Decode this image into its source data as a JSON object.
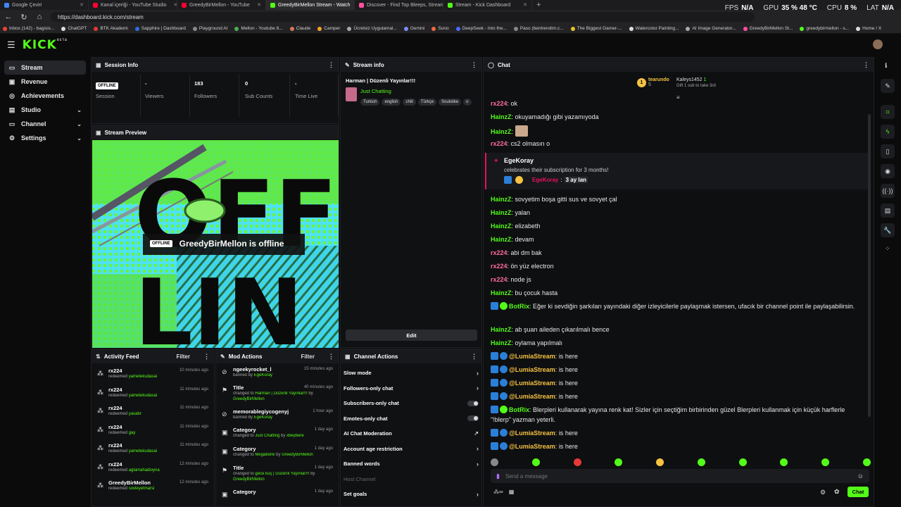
{
  "browser": {
    "tabs": [
      {
        "label": "Google Çeviri",
        "color": "#4285f4"
      },
      {
        "label": "Kanal içeriği - YouTube Studio",
        "color": "#ff0033"
      },
      {
        "label": "GreedyBirMellon - YouTube",
        "color": "#ff0033"
      },
      {
        "label": "GreedyBirMellon Stream - Watch",
        "color": "#53fc18"
      },
      {
        "label": "Discover - Find Top Bleeps, Stream",
        "color": "#ff4fa0"
      },
      {
        "label": "Stream - Kick Dashboard",
        "color": "#53fc18"
      }
    ],
    "new_tab": "+",
    "url": "https://dashboard.kick.com/stream",
    "perf": {
      "fps_label": "FPS",
      "fps_value": "N/A",
      "gpu_label": "GPU",
      "gpu_value": "35 %  48 °C",
      "cpu_label": "CPU",
      "cpu_value": "8 %",
      "lat_label": "LAT",
      "lat_value": "N/A"
    },
    "bookmarks": [
      {
        "label": "Inbox (142) - bagisis...",
        "color": "#ea4335"
      },
      {
        "label": "ChatGPT",
        "color": "#ddd"
      },
      {
        "label": "BTK Akademi",
        "color": "#e53935"
      },
      {
        "label": "Sapphire | Dashboard",
        "color": "#2d6cdf"
      },
      {
        "label": "Playground AI",
        "color": "#888"
      },
      {
        "label": "Mellon - Youtube 8...",
        "color": "#4caf50"
      },
      {
        "label": "Claude",
        "color": "#d97757"
      },
      {
        "label": "Camper",
        "color": "#f5a623"
      },
      {
        "label": "Ücretsiz Uygulamal...",
        "color": "#aaa"
      },
      {
        "label": "Gemini",
        "color": "#7b8cff"
      },
      {
        "label": "Suno",
        "color": "#f2683c"
      },
      {
        "label": "DeepSeek - Into the...",
        "color": "#4d6bfe"
      },
      {
        "label": "Paso (bentrendim.c...",
        "color": "#888"
      },
      {
        "label": "The Biggest Gamer-...",
        "color": "#e6c229"
      },
      {
        "label": "Watercolor Painting...",
        "color": "#ddd"
      },
      {
        "label": "AI Image Generator...",
        "color": "#aaa"
      },
      {
        "label": "GreedyBirMellon St...",
        "color": "#ff4fa0"
      },
      {
        "label": "greedybirmellon - s...",
        "color": "#53fc18"
      },
      {
        "label": "Home / X",
        "color": "#ddd"
      }
    ]
  },
  "app": {
    "logo": "KICK",
    "logo_sup": "BETA"
  },
  "sidebar": {
    "items": [
      {
        "label": "Stream",
        "icon": "▭",
        "chevron": ""
      },
      {
        "label": "Revenue",
        "icon": "▣",
        "chevron": ""
      },
      {
        "label": "Achievements",
        "icon": "◎",
        "chevron": ""
      },
      {
        "label": "Studio",
        "icon": "▤",
        "chevron": "⌄"
      },
      {
        "label": "Channel",
        "icon": "▭",
        "chevron": "⌄"
      },
      {
        "label": "Settings",
        "icon": "⚙",
        "chevron": "⌄"
      }
    ]
  },
  "session": {
    "title": "Session Info",
    "badge": "OFFLINE",
    "stats": [
      {
        "value": "",
        "label": "Session"
      },
      {
        "value": "-",
        "label": "Viewers"
      },
      {
        "value": "183",
        "label": "Followers"
      },
      {
        "value": "0",
        "label": "Sub Counts"
      },
      {
        "value": "-",
        "label": "Time Live"
      }
    ]
  },
  "preview": {
    "title": "Stream Preview",
    "badge": "OFFLINE",
    "offline_text": "GreedyBirMellon is offline",
    "art_text_top": "OFF",
    "art_text_bottom": "LIN"
  },
  "stream_info": {
    "title": "Stream info",
    "stream_title": "Harman | Düzenli Yayınlar!!!",
    "category": "Just Chatting",
    "tags": [
      "Turkish",
      "english",
      "chill",
      "Türkçe",
      "Soulslike",
      "o"
    ],
    "edit_label": "Edit"
  },
  "activity": {
    "title": "Activity Feed",
    "filter": "Filter",
    "rows": [
      {
        "name": "rx224",
        "action": "redeemed",
        "item": "yametekudasai",
        "time": "10 minutes ago"
      },
      {
        "name": "rx224",
        "action": "redeemed",
        "item": "yametekudasai",
        "time": "11 minutes ago"
      },
      {
        "name": "rx224",
        "action": "redeemed",
        "item": "yasabr",
        "time": "11 minutes ago"
      },
      {
        "name": "rx224",
        "action": "redeemed",
        "item": "gay",
        "time": "11 minutes ago"
      },
      {
        "name": "rx224",
        "action": "redeemed",
        "item": "yametekudasai",
        "time": "11 minutes ago"
      },
      {
        "name": "rx224",
        "action": "redeemed",
        "item": "aglamahadioyna",
        "time": "12 minutes ago"
      },
      {
        "name": "GreedyBirMellon",
        "action": "redeemed",
        "item": "sovleyetmarsi",
        "time": "12 minutes ago"
      }
    ]
  },
  "mod_actions": {
    "title": "Mod Actions",
    "filter": "Filter",
    "rows": [
      {
        "name": "ngeekyrocket_l",
        "l1_pre": "banned by ",
        "l1_hl": "EgeKoray",
        "l2": "",
        "time": "15 minutes ago"
      },
      {
        "name": "Title",
        "l1_pre": "changed to ",
        "l1_hl": "Harman | Düzenli Yayınlar!!!",
        "l1_post": " by",
        "l2": "GreedyBirMellon",
        "time": "40 minutes ago"
      },
      {
        "name": "memorablegiycogenyj",
        "l1_pre": "banned by ",
        "l1_hl": "EgeKoray",
        "l2": "",
        "time": "1 hour ago"
      },
      {
        "name": "Category",
        "l1_pre": "changed to ",
        "l1_hl": "Just Chatting",
        "l1_post": " by ",
        "l1_hl2": "xbeybere",
        "l2": "",
        "time": "1 day ago"
      },
      {
        "name": "Category",
        "l1_pre": "changed to ",
        "l1_hl": "Megabonk",
        "l1_post": " by ",
        "l1_hl2": "GreedyBirMellon",
        "l2": "",
        "time": "1 day ago"
      },
      {
        "name": "Title",
        "l1_pre": "changed to ",
        "l1_hl": "gece kuş | Düzenli Yayınlar!!!",
        "l1_post": " by",
        "l2": "GreedyBirMellon",
        "time": "1 day ago"
      },
      {
        "name": "Category",
        "l1_pre": "",
        "l1_hl": "",
        "l2": "",
        "time": "1 day ago"
      }
    ]
  },
  "channel_actions": {
    "title": "Channel Actions",
    "rows": [
      {
        "label": "Slow mode",
        "ctrl": "chevron"
      },
      {
        "label": "Followers-only chat",
        "ctrl": "chevron"
      },
      {
        "label": "Subscribers-only chat",
        "ctrl": "toggle"
      },
      {
        "label": "Emotes-only chat",
        "ctrl": "toggle"
      },
      {
        "label": "AI Chat Moderation",
        "ctrl": "external"
      },
      {
        "label": "Account age restriction",
        "ctrl": "chevron"
      },
      {
        "label": "Banned words",
        "ctrl": "chevron"
      },
      {
        "label": "Host Channel",
        "ctrl": "none",
        "muted": true
      },
      {
        "label": "Set goals",
        "ctrl": "chevron"
      }
    ]
  },
  "chat": {
    "title": "Chat",
    "top_gifter": {
      "rank": "1",
      "name": "tearundo",
      "count": "5"
    },
    "second_gifter": {
      "name": "Kaleys1452",
      "count": "1"
    },
    "gift_prompt": "Gift 1 sub to take 3rd",
    "sub_card": {
      "name": "EgeKoray",
      "text": "celebrates their subscription for 3 months!",
      "reply_user": "EgeKoray",
      "reply_text": "3 ay lan"
    },
    "messages": [
      {
        "user": "rx224",
        "cls": "u-rx",
        "text": "ok",
        "icons": []
      },
      {
        "user": "HainzZ",
        "cls": "u-hz",
        "text": "okuyamadığı gibi yazamıyoda",
        "icons": []
      },
      {
        "user": "HainzZ",
        "cls": "u-hz",
        "text": "",
        "icons": [],
        "emote": true
      },
      {
        "user": "rx224",
        "cls": "u-rx",
        "text": "cs2 olmasın o",
        "icons": []
      },
      {
        "user": "HainzZ",
        "cls": "u-hz",
        "text": "sovyetim boşa gitti sus ve sovyet çal",
        "icons": []
      },
      {
        "user": "HainzZ",
        "cls": "u-hz",
        "text": "yalan",
        "icons": []
      },
      {
        "user": "HainzZ",
        "cls": "u-hz",
        "text": "elizabeth",
        "icons": []
      },
      {
        "user": "HainzZ",
        "cls": "u-hz",
        "text": "devam",
        "icons": []
      },
      {
        "user": "rx224",
        "cls": "u-rx",
        "text": "abi dm bak",
        "icons": []
      },
      {
        "user": "rx224",
        "cls": "u-rx",
        "text": "ön yüz electron",
        "icons": []
      },
      {
        "user": "rx224",
        "cls": "u-rx",
        "text": "node js",
        "icons": []
      },
      {
        "user": "HainzZ",
        "cls": "u-hz",
        "text": "bu çocuk hasta",
        "icons": []
      },
      {
        "user": "BotRix",
        "cls": "u-bot",
        "text": "Eğer ki sevdiğin şarkıları yayındaki diğer izleyicilerle paylaşmak istersen, ufacık bir channel point ile paylaşabilirsin.",
        "icons": [
          "#2b7fd6",
          "#53fc18"
        ]
      },
      {
        "user": "HainzZ",
        "cls": "u-hz",
        "text": "ab şuan aileden çıkarılmalı bence",
        "icons": []
      },
      {
        "user": "HainzZ",
        "cls": "u-hz",
        "text": "oylama yapılmalı",
        "icons": []
      },
      {
        "user": "@LumiaStream",
        "cls": "u-lu",
        "text": "is here",
        "icons": [
          "#2b7fd6",
          "#2b7fd6"
        ]
      },
      {
        "user": "@LumiaStream",
        "cls": "u-lu",
        "text": "is here",
        "icons": [
          "#2b7fd6",
          "#2b7fd6"
        ]
      },
      {
        "user": "@LumiaStream",
        "cls": "u-lu",
        "text": "is here",
        "icons": [
          "#2b7fd6",
          "#2b7fd6"
        ]
      },
      {
        "user": "@LumiaStream",
        "cls": "u-lu",
        "text": "is here",
        "icons": [
          "#2b7fd6",
          "#2b7fd6"
        ]
      },
      {
        "user": "BotRix",
        "cls": "u-bot",
        "text": "Blerpleri kullanarak yayına renk kat! Sizler için seçtiğim birbirinden güzel Blerpleri kullanmak için küçük harflerle \"!blerp\" yazman yeterli.",
        "icons": [
          "#2b7fd6",
          "#53fc18"
        ]
      },
      {
        "user": "@LumiaStream",
        "cls": "u-lu",
        "text": "is here",
        "icons": [
          "#2b7fd6",
          "#2b7fd6"
        ]
      },
      {
        "user": "@LumiaStream",
        "cls": "u-lu",
        "text": "is here",
        "icons": [
          "#2b7fd6",
          "#2b7fd6"
        ]
      }
    ],
    "input_placeholder": "Send a message",
    "send_label": "Chat"
  },
  "colors": {
    "accent": "#53fc18",
    "panel": "#101113",
    "bg": "#0b0b0c"
  }
}
